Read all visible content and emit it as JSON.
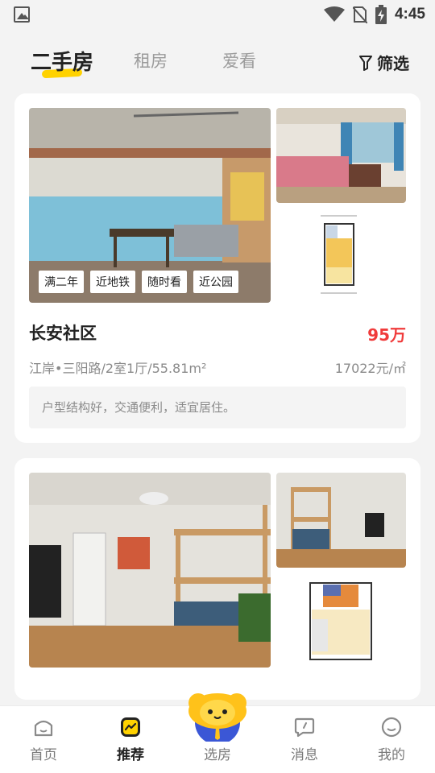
{
  "status_bar": {
    "time": "4:45"
  },
  "tabs": {
    "items": [
      {
        "label": "二手房",
        "active": true
      },
      {
        "label": "租房",
        "active": false
      },
      {
        "label": "爱看",
        "active": false
      }
    ]
  },
  "filter": {
    "label": "筛选"
  },
  "listings": [
    {
      "tags": [
        "满二年",
        "近地铁",
        "随时看",
        "近公园"
      ],
      "name": "长安社区",
      "price": "95万",
      "meta": "江岸•三阳路/2室1厅/55.81m²",
      "unit_price": "17022元/㎡",
      "desc": "户型结构好，交通便利，适宜居住。"
    }
  ],
  "bottom_nav": {
    "items": [
      {
        "label": "首页"
      },
      {
        "label": "推荐",
        "active": true
      },
      {
        "label": "选房"
      },
      {
        "label": "消息"
      },
      {
        "label": "我的"
      }
    ]
  },
  "colors": {
    "accent": "#ffd200",
    "price": "#f03b3b"
  }
}
